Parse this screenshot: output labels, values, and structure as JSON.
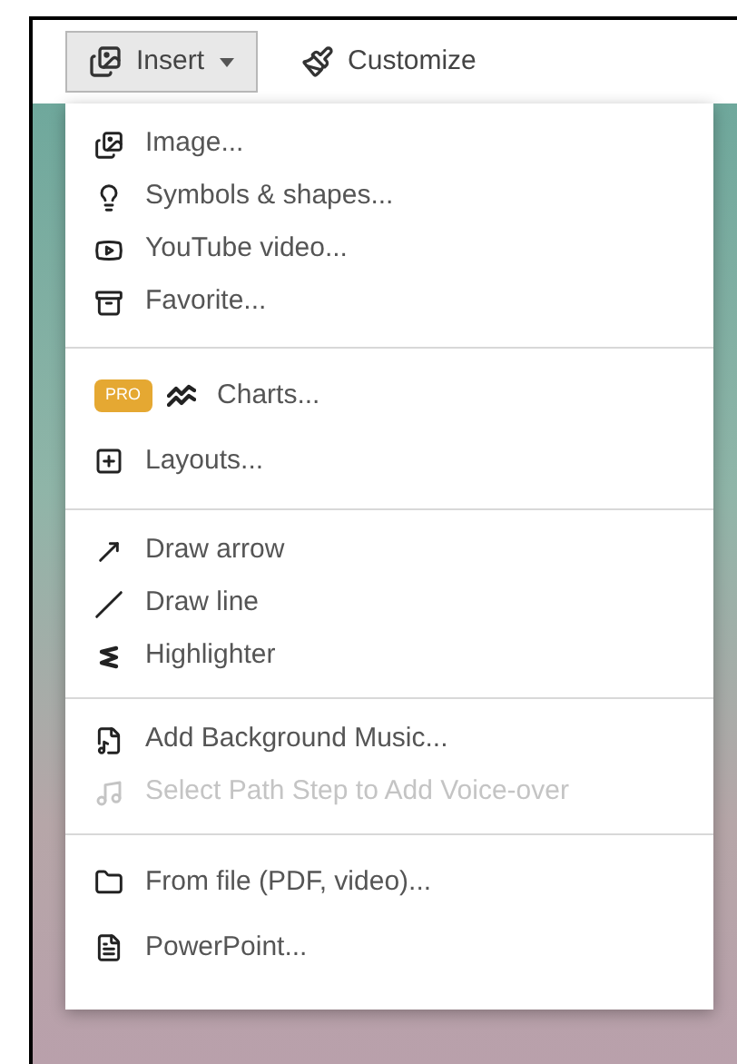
{
  "toolbar": {
    "buttons": [
      {
        "label": "Insert",
        "selected": true,
        "has_caret": true
      },
      {
        "label": "Customize",
        "selected": false,
        "has_caret": false
      }
    ]
  },
  "menu": {
    "sections": [
      {
        "items": [
          {
            "label": "Image...",
            "disabled": false
          },
          {
            "label": "Symbols & shapes...",
            "disabled": false
          },
          {
            "label": "YouTube video...",
            "disabled": false
          },
          {
            "label": "Favorite...",
            "disabled": false
          }
        ]
      },
      {
        "items": [
          {
            "label": "Charts...",
            "disabled": false,
            "badge": "PRO"
          },
          {
            "label": "Layouts...",
            "disabled": false
          }
        ]
      },
      {
        "items": [
          {
            "label": "Draw arrow",
            "disabled": false
          },
          {
            "label": "Draw line",
            "disabled": false
          },
          {
            "label": "Highlighter",
            "disabled": false
          }
        ]
      },
      {
        "items": [
          {
            "label": "Add Background Music...",
            "disabled": false
          },
          {
            "label": "Select Path Step to Add Voice-over",
            "disabled": true
          }
        ]
      },
      {
        "items": [
          {
            "label": "From file (PDF, video)...",
            "disabled": false
          },
          {
            "label": "PowerPoint...",
            "disabled": false
          }
        ]
      }
    ]
  }
}
